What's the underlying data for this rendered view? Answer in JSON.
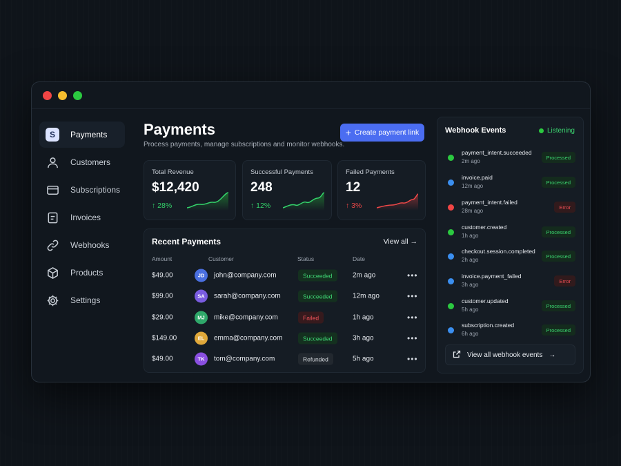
{
  "sidebar": {
    "items": [
      {
        "label": "Payments",
        "icon": "s-badge",
        "badge": "S"
      },
      {
        "label": "Customers",
        "icon": "user-icon"
      },
      {
        "label": "Subscriptions",
        "icon": "card-icon"
      },
      {
        "label": "Invoices",
        "icon": "document-icon"
      },
      {
        "label": "Webhooks",
        "icon": "link-icon"
      },
      {
        "label": "Products",
        "icon": "box-icon"
      },
      {
        "label": "Settings",
        "icon": "gear-icon"
      }
    ]
  },
  "header": {
    "title": "Payments",
    "subtitle": "Process payments, manage subscriptions and monitor webhooks.",
    "create_button": "Create payment link"
  },
  "stats": [
    {
      "label": "Total Revenue",
      "value": "$12,420",
      "change": "28%",
      "direction": "up"
    },
    {
      "label": "Successful Payments",
      "value": "248",
      "change": "12%",
      "direction": "up"
    },
    {
      "label": "Failed Payments",
      "value": "12",
      "change": "3%",
      "direction": "down"
    }
  ],
  "recent": {
    "title": "Recent Payments",
    "view_all": "View all",
    "columns": [
      "Amount",
      "Customer",
      "Status",
      "Date"
    ],
    "rows": [
      {
        "amount": "$49.00",
        "initials": "JD",
        "email": "john@company.com",
        "status": "Succeeded",
        "date": "2m ago",
        "avatar_color": "#4a6fe0"
      },
      {
        "amount": "$99.00",
        "initials": "SA",
        "email": "sarah@company.com",
        "status": "Succeeded",
        "date": "12m ago",
        "avatar_color": "#7a5ce0"
      },
      {
        "amount": "$29.00",
        "initials": "MJ",
        "email": "mike@company.com",
        "status": "Failed",
        "date": "1h ago",
        "avatar_color": "#2fa86a"
      },
      {
        "amount": "$149.00",
        "initials": "EL",
        "email": "emma@company.com",
        "status": "Succeeded",
        "date": "3h ago",
        "avatar_color": "#e0a83a"
      },
      {
        "amount": "$49.00",
        "initials": "TK",
        "email": "tom@company.com",
        "status": "Refunded",
        "date": "5h ago",
        "avatar_color": "#8a4fe0"
      }
    ]
  },
  "webhooks": {
    "title": "Webhook Events",
    "status": "Listening",
    "events": [
      {
        "name": "payment_intent.succeeded",
        "time": "2m ago",
        "status": "Processed",
        "color": "#2bc940"
      },
      {
        "name": "invoice.paid",
        "time": "12m ago",
        "status": "Processed",
        "color": "#3b8ff0"
      },
      {
        "name": "payment_intent.failed",
        "time": "28m ago",
        "status": "Error",
        "color": "#f04545"
      },
      {
        "name": "customer.created",
        "time": "1h ago",
        "status": "Processed",
        "color": "#2bc940"
      },
      {
        "name": "checkout.session.completed",
        "time": "2h ago",
        "status": "Processed",
        "color": "#3b8ff0"
      },
      {
        "name": "invoice.payment_failed",
        "time": "3h ago",
        "status": "Error",
        "color": "#3b8ff0"
      },
      {
        "name": "customer.updated",
        "time": "5h ago",
        "status": "Processed",
        "color": "#2bc940"
      },
      {
        "name": "subscription.created",
        "time": "6h ago",
        "status": "Processed",
        "color": "#3b8ff0"
      }
    ],
    "footer": "View all webhook events"
  }
}
